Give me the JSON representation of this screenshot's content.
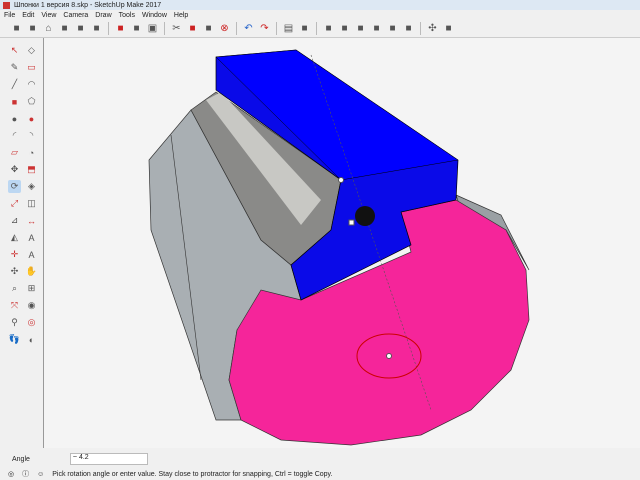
{
  "window": {
    "title": "Шпонки 1 версия 8.skp - SketchUp Make 2017"
  },
  "menu": [
    "File",
    "Edit",
    "View",
    "Camera",
    "Draw",
    "Tools",
    "Window",
    "Help"
  ],
  "toolbar": [
    "views-icon",
    "iso-icon",
    "home-icon",
    "top-icon",
    "front-icon",
    "right-icon",
    "open-red-icon",
    "open-folder-icon",
    "save-icon",
    "cut-icon",
    "paint-icon",
    "paste-icon",
    "delete-icon",
    "undo-icon",
    "redo-icon",
    "print-icon",
    "model-info-icon",
    "xray-icon",
    "wireframe-icon",
    "hidden-line-icon",
    "shaded-icon",
    "shaded-texture-icon",
    "monochrome-icon",
    "orbit-icon",
    "section-icon"
  ],
  "left_tools": [
    "select",
    "eraser",
    "paint",
    "eraser2",
    "pencil",
    "arc",
    "rectangle",
    "polygon",
    "circle",
    "circle2",
    "arc2",
    "arc3",
    "rotated",
    "pie",
    "move",
    "pushpull",
    "rotate",
    "followme",
    "scale",
    "offset",
    "tape",
    "dimension",
    "protractor",
    "text",
    "axes",
    "3dtext",
    "orbit",
    "pan",
    "zoom",
    "zoomwindow",
    "zoomext",
    "prev",
    "position",
    "lookaround",
    "walk",
    "section"
  ],
  "vcb": {
    "label": "Angle",
    "value": "~ 4.2"
  },
  "status": {
    "text": "Pick rotation angle or enter value.  Stay close to protractor for snapping, Ctrl = toggle Copy."
  },
  "colors": {
    "blue": "#0a0ae8",
    "pink": "#f5259a",
    "gray": "#a9afb3"
  }
}
